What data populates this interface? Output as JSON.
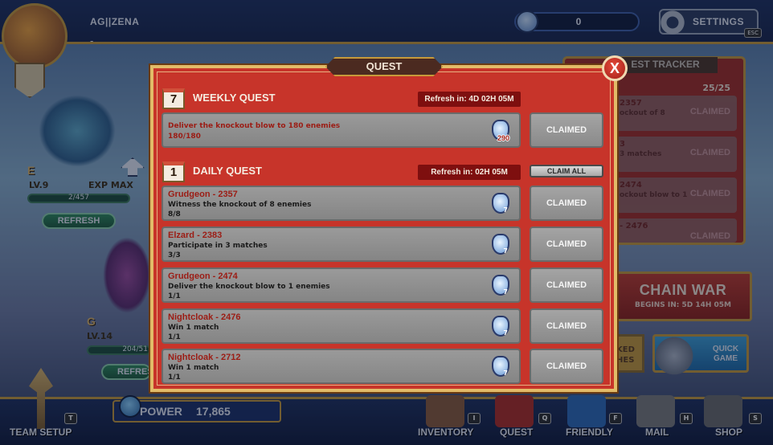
{
  "player": {
    "name": "AG||ZENA",
    "sub": "-"
  },
  "currency": {
    "icon": "gem-icon",
    "value": "0"
  },
  "settings": {
    "label": "SETTINGS",
    "key": "ESC"
  },
  "team_slots": [
    {
      "letter": "E",
      "level": "LV.9",
      "exp": "EXP MAX",
      "bar": "2/457",
      "refresh": "REFRESH"
    },
    {
      "letter": "G",
      "level": "LV.14",
      "exp": "",
      "bar": "204/51",
      "refresh": "REFRES"
    }
  ],
  "tracker": {
    "title": "EST TRACKER",
    "count": "25/25",
    "items": [
      {
        "name": "2357",
        "desc": "ockout of 8",
        "status": "CLAIMED"
      },
      {
        "name": "3",
        "desc": "3 matches",
        "status": "CLAIMED"
      },
      {
        "name": "2474",
        "desc": "ockout blow to 1",
        "status": "CLAIMED"
      },
      {
        "name": "- 2476",
        "desc": "",
        "status": "CLAIMED"
      }
    ]
  },
  "chain_war": {
    "title": "CHAIN WAR",
    "sub": "BEGINS IN: 5D 14H 05M"
  },
  "ranked": {
    "label": "KED\nHES"
  },
  "quick_game": {
    "label": "QUICK\nGAME"
  },
  "power": {
    "label": "POWER",
    "value": "17,865"
  },
  "nav": [
    {
      "label": "TEAM SETUP",
      "key": "T"
    },
    {
      "label": "INVENTORY",
      "key": "I"
    },
    {
      "label": "QUEST",
      "key": "Q"
    },
    {
      "label": "FRIENDLY",
      "key": "F"
    },
    {
      "label": "MAIL",
      "key": "H"
    },
    {
      "label": "SHOP",
      "key": "S"
    }
  ],
  "quest": {
    "title": "QUEST",
    "close": "X",
    "weekly": {
      "num": "7",
      "title": "WEEKLY QUEST",
      "refresh": "Refresh in: 4D 02H 05M",
      "items": [
        {
          "desc": "Deliver the knockout blow to 180 enemies",
          "progress": "180/180",
          "reward": "290",
          "status": "CLAIMED"
        }
      ]
    },
    "daily": {
      "num": "1",
      "title": "DAILY QUEST",
      "refresh": "Refresh in: 02H 05M",
      "claim_all": "CLAIM ALL",
      "items": [
        {
          "name": "Grudgeon - 2357",
          "desc": "Witness the knockout of 8 enemies",
          "progress": "8/8",
          "reward": "7",
          "status": "CLAIMED"
        },
        {
          "name": "Elzard - 2383",
          "desc": "Participate in 3 matches",
          "progress": "3/3",
          "reward": "7",
          "status": "CLAIMED"
        },
        {
          "name": "Grudgeon - 2474",
          "desc": "Deliver the knockout blow to 1 enemies",
          "progress": "1/1",
          "reward": "7",
          "status": "CLAIMED"
        },
        {
          "name": "Nightcloak - 2476",
          "desc": "Win 1 match",
          "progress": "1/1",
          "reward": "7",
          "status": "CLAIMED"
        },
        {
          "name": "Nightcloak - 2712",
          "desc": "Win 1 match",
          "progress": "1/1",
          "reward": "7",
          "status": "CLAIMED"
        }
      ]
    }
  }
}
